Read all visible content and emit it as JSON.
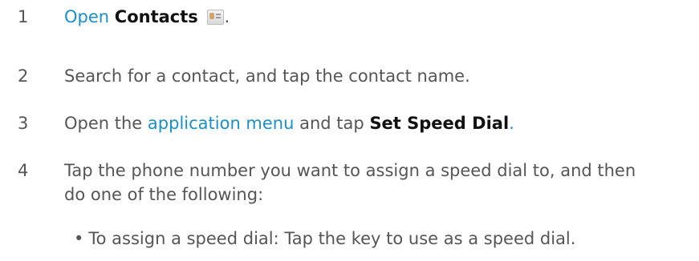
{
  "steps": [
    {
      "number": "1",
      "open_link": "Open",
      "app_name": "Contacts",
      "after": "."
    },
    {
      "number": "2",
      "text": "Search for a contact, and tap the contact name."
    },
    {
      "number": "3",
      "before": "Open the",
      "menu_link": "application menu",
      "middle": "and tap",
      "action": "Set Speed Dial",
      "after": "."
    },
    {
      "number": "4",
      "line1": "Tap the phone number you want to assign a speed dial to, and then",
      "line2": "do one of the following:"
    }
  ],
  "bullet": {
    "marker": "•",
    "text": "To assign a speed dial: Tap the key to use as a speed dial."
  },
  "icons": {
    "contacts": "contacts-app-icon"
  },
  "colors": {
    "link": "#1a8fc8",
    "body_text": "#555555",
    "bold_text": "#111111"
  }
}
